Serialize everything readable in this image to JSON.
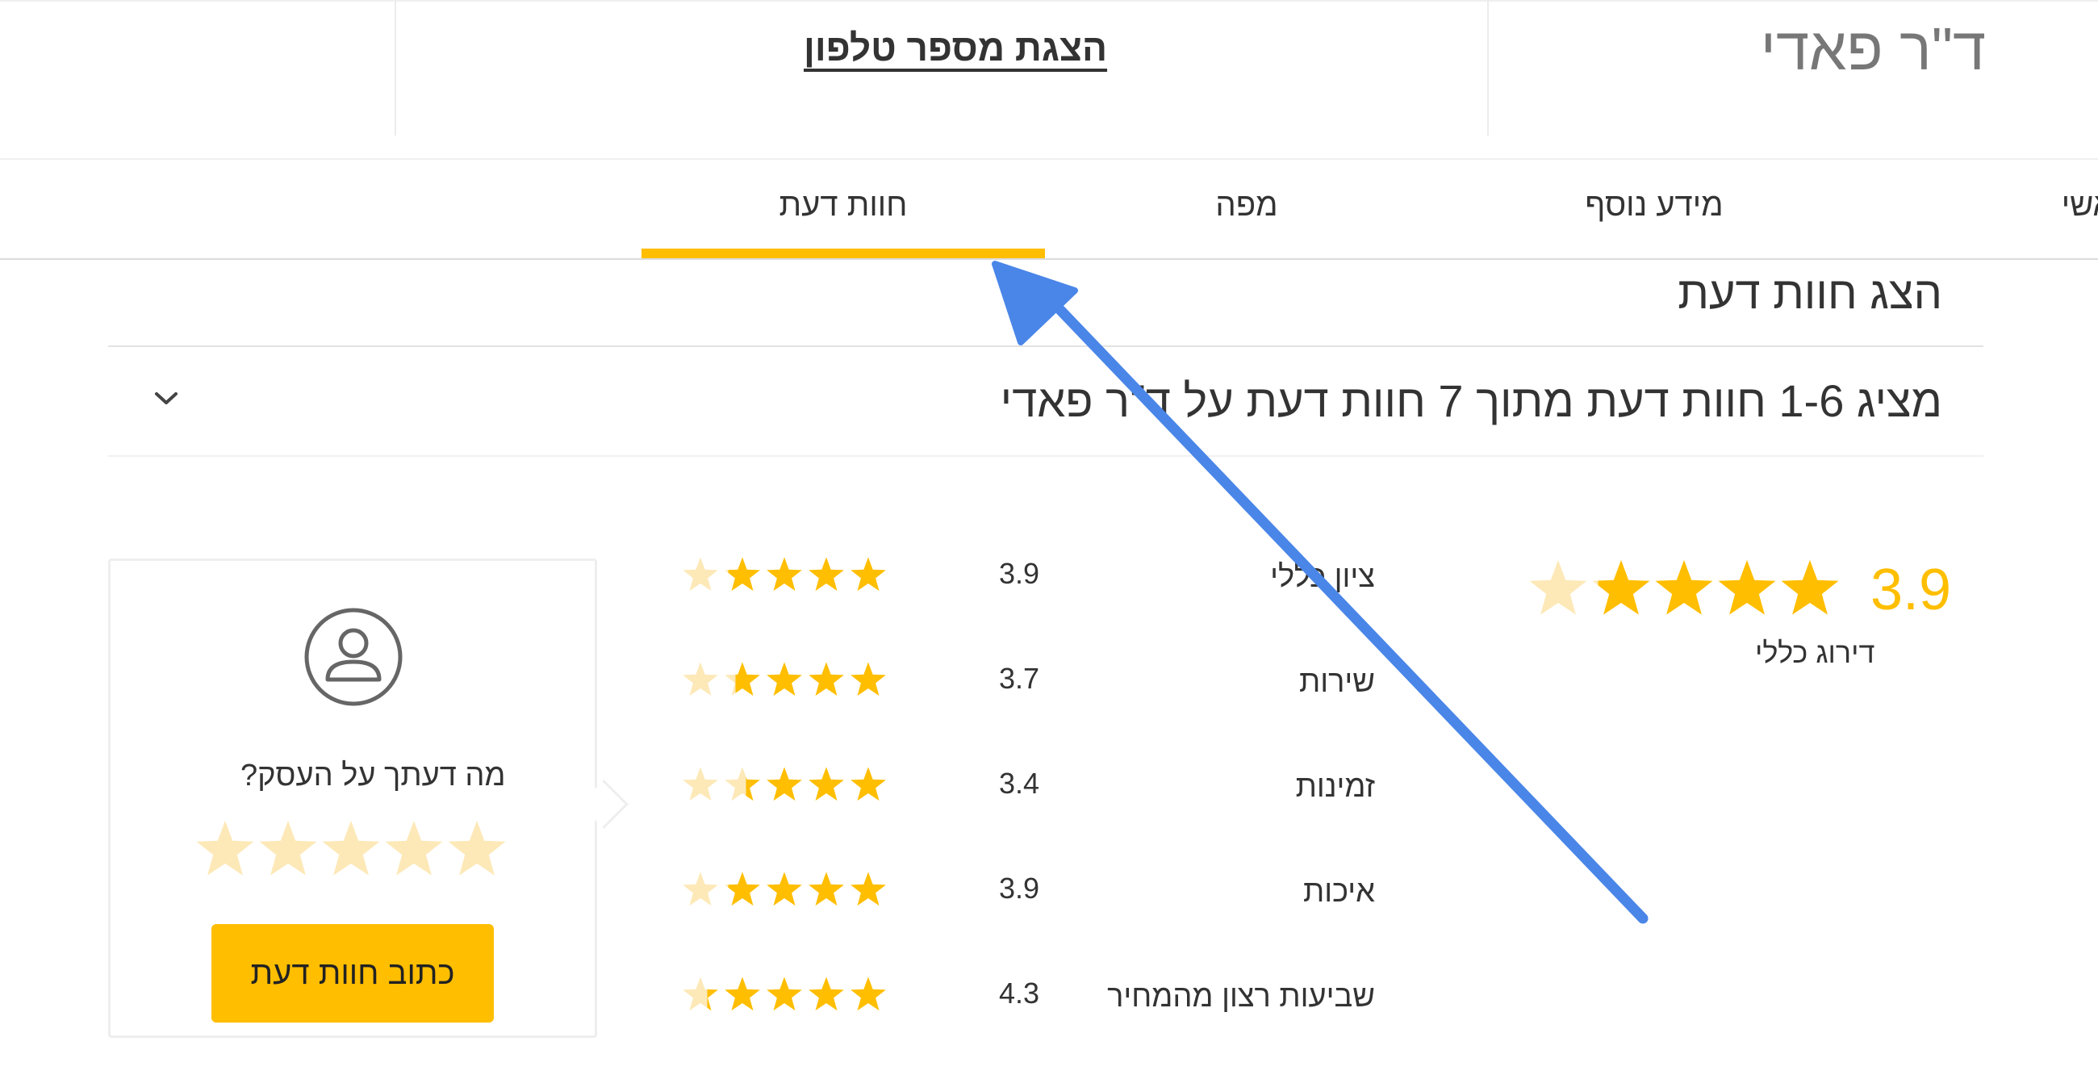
{
  "header": {
    "business_name": "ד\"ר פאדי",
    "show_phone_label": "הצגת מספר טלפון"
  },
  "tabs": [
    {
      "label": "ראשי"
    },
    {
      "label": "מידע נוסף"
    },
    {
      "label": "מפה"
    },
    {
      "label": "חוות דעת",
      "active": true
    }
  ],
  "reviews": {
    "section_title": "הצג חוות דעת",
    "summary_text": "מציג 1-6 חוות דעת מתוך 7 חוות דעת על ד\"ר פאדי",
    "overall": {
      "value": "3.9",
      "label": "דירוג כללי",
      "rating": 3.9
    },
    "categories": [
      {
        "label": "ציון כללי",
        "value": "3.9",
        "rating": 3.9
      },
      {
        "label": "שירות",
        "value": "3.7",
        "rating": 3.7
      },
      {
        "label": "זמינות",
        "value": "3.4",
        "rating": 3.4
      },
      {
        "label": "איכות",
        "value": "3.9",
        "rating": 3.9
      },
      {
        "label": "שביעות רצון מהמחיר",
        "value": "4.3",
        "rating": 4.3
      }
    ]
  },
  "write_review": {
    "question": "מה דעתך על העסק?",
    "button_label": "כתוב חוות דעת",
    "empty_stars": 5
  },
  "colors": {
    "accent": "#ffbe00",
    "star_empty": "#fde9b8",
    "annotation_arrow": "#4a86e8"
  },
  "icons": {
    "avatar": "user-avatar-icon",
    "dropdown": "chevron-down-icon",
    "star": "star-icon"
  }
}
